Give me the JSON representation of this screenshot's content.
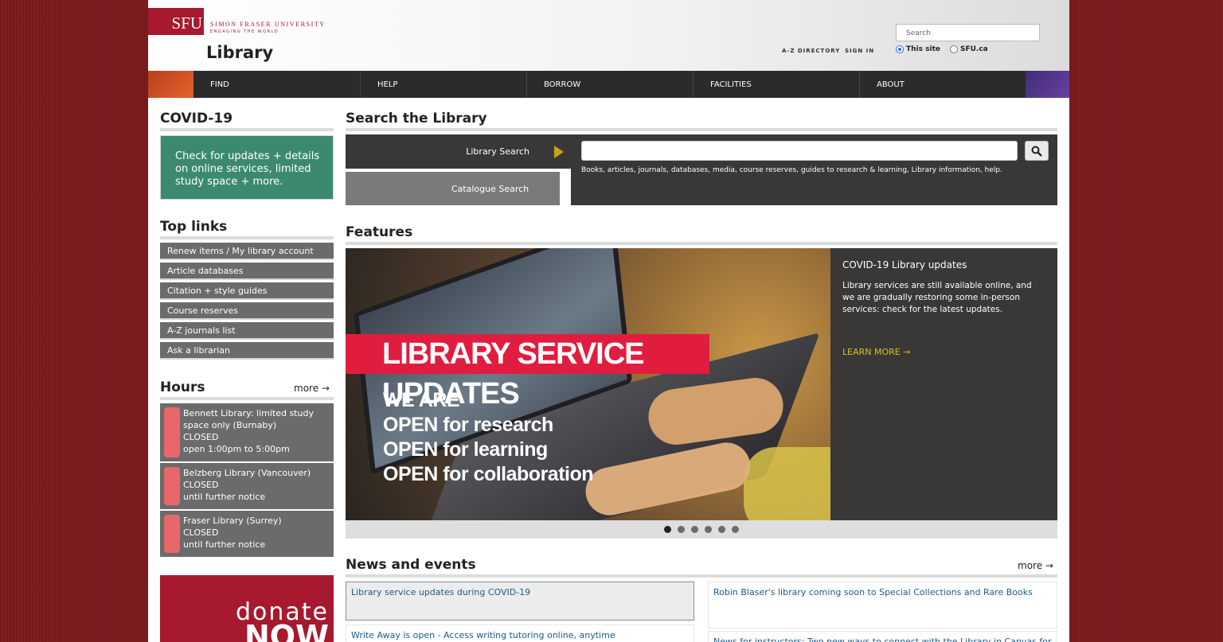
{
  "header": {
    "logo_mark": "SFU",
    "university_name": "SIMON FRASER UNIVERSITY",
    "tagline": "ENGAGING THE WORLD",
    "site_title": "Library",
    "links": [
      "A-Z DIRECTORY",
      "SIGN IN"
    ],
    "search_placeholder": "Search",
    "scope_options": [
      "This site",
      "SFU.ca"
    ],
    "scope_selected": "This site"
  },
  "nav": [
    "FIND",
    "HELP",
    "BORROW",
    "FACILITIES",
    "ABOUT"
  ],
  "covid": {
    "heading": "COVID-19",
    "box_text": "Check for updates + details on online services, limited study space + more."
  },
  "top_links": {
    "heading": "Top links",
    "items": [
      "Renew items / My library account",
      "Article databases",
      "Citation + style guides",
      "Course reserves",
      "A-Z journals list",
      "Ask a librarian"
    ]
  },
  "hours": {
    "heading": "Hours",
    "more": "more",
    "libraries": [
      {
        "name": "Bennett Library: limited study space only (Burnaby)",
        "status": "CLOSED",
        "note": "open 1:00pm to 5:00pm"
      },
      {
        "name": "Belzberg Library (Vancouver)",
        "status": "CLOSED",
        "note": "until further notice"
      },
      {
        "name": "Fraser Library (Surrey)",
        "status": "CLOSED",
        "note": "until further notice"
      }
    ]
  },
  "donate": {
    "line1": "donate",
    "line2": "NOW"
  },
  "search_section": {
    "heading": "Search the Library",
    "tabs": [
      "Library Search",
      "Catalogue Search"
    ],
    "active_tab": "Library Search",
    "input_value": "",
    "hint": "Books, articles, journals, databases, media, course reserves, guides to research & learning, Library information, help."
  },
  "features": {
    "heading": "Features",
    "slide_banner": "LIBRARY SERVICE UPDATES",
    "slide_lines": [
      "WE ARE",
      "OPEN for research",
      "OPEN for learning",
      "OPEN for collaboration"
    ],
    "title": "COVID-19 Library updates",
    "body": "Library services are still available online, and we are gradually restoring some in-person services: check for the latest updates.",
    "learn_more": "LEARN MORE",
    "slide_count": 6,
    "active_slide": 1
  },
  "news": {
    "heading": "News and events",
    "more": "more",
    "items": [
      "Library service updates during COVID-19",
      "Robin Blaser's library coming soon to Special Collections and Rare Books",
      "Write Away is open - Access writing tutoring online, anytime",
      "News for instructors: Two new ways to connect with the Library in Canvas for"
    ]
  },
  "colors": {
    "sfu_red": "#a6192e",
    "covid_green": "#3b8a70",
    "nav_dark": "#2b2b2b",
    "panel_dark": "#3a3737",
    "gray_item": "#6b6b6b",
    "hours_flag": "#e8676b",
    "banner_red": "#e11d3f",
    "learn_more": "#d4c02a",
    "link_blue": "#1c5a8a"
  }
}
